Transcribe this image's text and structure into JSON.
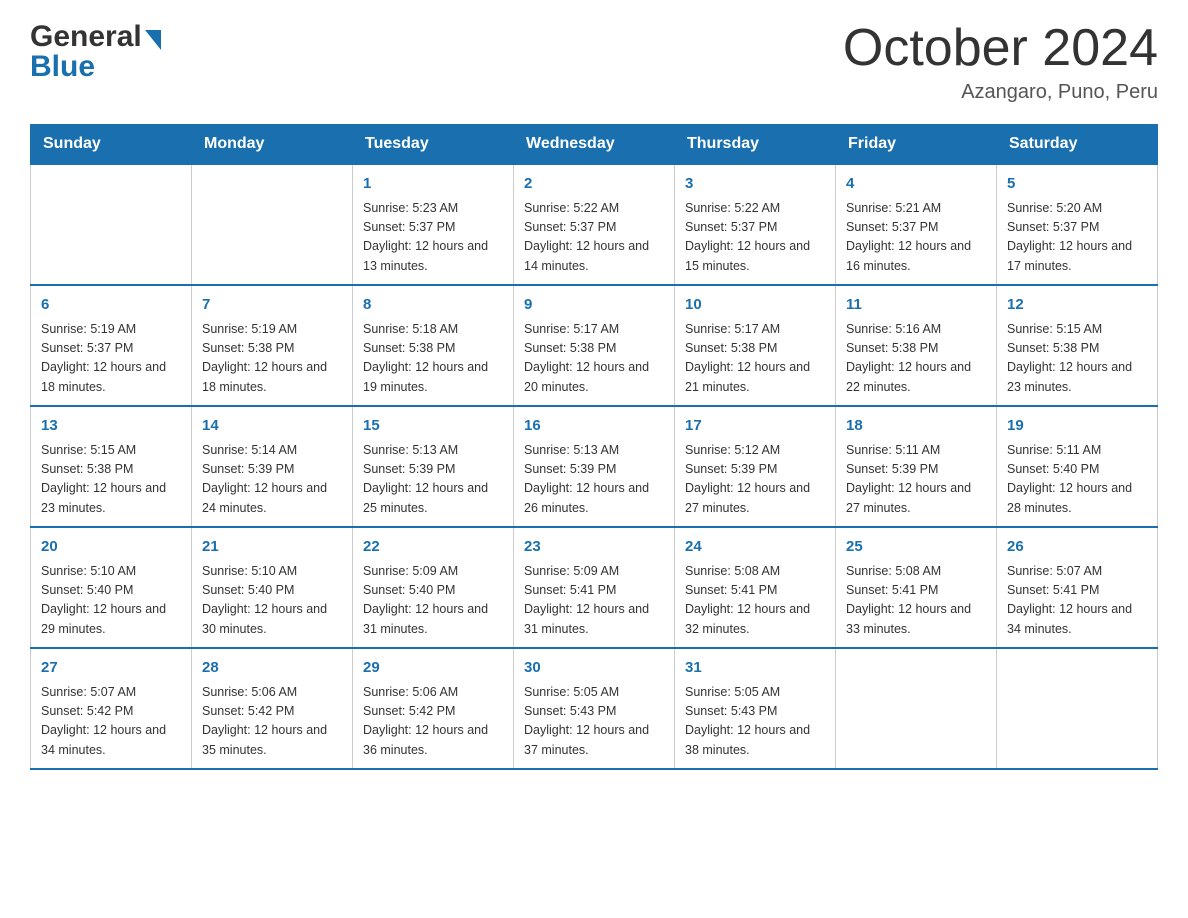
{
  "logo": {
    "general": "General",
    "blue": "Blue",
    "arrow": "▶"
  },
  "title": {
    "month": "October 2024",
    "location": "Azangaro, Puno, Peru"
  },
  "headers": [
    "Sunday",
    "Monday",
    "Tuesday",
    "Wednesday",
    "Thursday",
    "Friday",
    "Saturday"
  ],
  "weeks": [
    [
      {
        "day": "",
        "sunrise": "",
        "sunset": "",
        "daylight": ""
      },
      {
        "day": "",
        "sunrise": "",
        "sunset": "",
        "daylight": ""
      },
      {
        "day": "1",
        "sunrise": "Sunrise: 5:23 AM",
        "sunset": "Sunset: 5:37 PM",
        "daylight": "Daylight: 12 hours and 13 minutes."
      },
      {
        "day": "2",
        "sunrise": "Sunrise: 5:22 AM",
        "sunset": "Sunset: 5:37 PM",
        "daylight": "Daylight: 12 hours and 14 minutes."
      },
      {
        "day": "3",
        "sunrise": "Sunrise: 5:22 AM",
        "sunset": "Sunset: 5:37 PM",
        "daylight": "Daylight: 12 hours and 15 minutes."
      },
      {
        "day": "4",
        "sunrise": "Sunrise: 5:21 AM",
        "sunset": "Sunset: 5:37 PM",
        "daylight": "Daylight: 12 hours and 16 minutes."
      },
      {
        "day": "5",
        "sunrise": "Sunrise: 5:20 AM",
        "sunset": "Sunset: 5:37 PM",
        "daylight": "Daylight: 12 hours and 17 minutes."
      }
    ],
    [
      {
        "day": "6",
        "sunrise": "Sunrise: 5:19 AM",
        "sunset": "Sunset: 5:37 PM",
        "daylight": "Daylight: 12 hours and 18 minutes."
      },
      {
        "day": "7",
        "sunrise": "Sunrise: 5:19 AM",
        "sunset": "Sunset: 5:38 PM",
        "daylight": "Daylight: 12 hours and 18 minutes."
      },
      {
        "day": "8",
        "sunrise": "Sunrise: 5:18 AM",
        "sunset": "Sunset: 5:38 PM",
        "daylight": "Daylight: 12 hours and 19 minutes."
      },
      {
        "day": "9",
        "sunrise": "Sunrise: 5:17 AM",
        "sunset": "Sunset: 5:38 PM",
        "daylight": "Daylight: 12 hours and 20 minutes."
      },
      {
        "day": "10",
        "sunrise": "Sunrise: 5:17 AM",
        "sunset": "Sunset: 5:38 PM",
        "daylight": "Daylight: 12 hours and 21 minutes."
      },
      {
        "day": "11",
        "sunrise": "Sunrise: 5:16 AM",
        "sunset": "Sunset: 5:38 PM",
        "daylight": "Daylight: 12 hours and 22 minutes."
      },
      {
        "day": "12",
        "sunrise": "Sunrise: 5:15 AM",
        "sunset": "Sunset: 5:38 PM",
        "daylight": "Daylight: 12 hours and 23 minutes."
      }
    ],
    [
      {
        "day": "13",
        "sunrise": "Sunrise: 5:15 AM",
        "sunset": "Sunset: 5:38 PM",
        "daylight": "Daylight: 12 hours and 23 minutes."
      },
      {
        "day": "14",
        "sunrise": "Sunrise: 5:14 AM",
        "sunset": "Sunset: 5:39 PM",
        "daylight": "Daylight: 12 hours and 24 minutes."
      },
      {
        "day": "15",
        "sunrise": "Sunrise: 5:13 AM",
        "sunset": "Sunset: 5:39 PM",
        "daylight": "Daylight: 12 hours and 25 minutes."
      },
      {
        "day": "16",
        "sunrise": "Sunrise: 5:13 AM",
        "sunset": "Sunset: 5:39 PM",
        "daylight": "Daylight: 12 hours and 26 minutes."
      },
      {
        "day": "17",
        "sunrise": "Sunrise: 5:12 AM",
        "sunset": "Sunset: 5:39 PM",
        "daylight": "Daylight: 12 hours and 27 minutes."
      },
      {
        "day": "18",
        "sunrise": "Sunrise: 5:11 AM",
        "sunset": "Sunset: 5:39 PM",
        "daylight": "Daylight: 12 hours and 27 minutes."
      },
      {
        "day": "19",
        "sunrise": "Sunrise: 5:11 AM",
        "sunset": "Sunset: 5:40 PM",
        "daylight": "Daylight: 12 hours and 28 minutes."
      }
    ],
    [
      {
        "day": "20",
        "sunrise": "Sunrise: 5:10 AM",
        "sunset": "Sunset: 5:40 PM",
        "daylight": "Daylight: 12 hours and 29 minutes."
      },
      {
        "day": "21",
        "sunrise": "Sunrise: 5:10 AM",
        "sunset": "Sunset: 5:40 PM",
        "daylight": "Daylight: 12 hours and 30 minutes."
      },
      {
        "day": "22",
        "sunrise": "Sunrise: 5:09 AM",
        "sunset": "Sunset: 5:40 PM",
        "daylight": "Daylight: 12 hours and 31 minutes."
      },
      {
        "day": "23",
        "sunrise": "Sunrise: 5:09 AM",
        "sunset": "Sunset: 5:41 PM",
        "daylight": "Daylight: 12 hours and 31 minutes."
      },
      {
        "day": "24",
        "sunrise": "Sunrise: 5:08 AM",
        "sunset": "Sunset: 5:41 PM",
        "daylight": "Daylight: 12 hours and 32 minutes."
      },
      {
        "day": "25",
        "sunrise": "Sunrise: 5:08 AM",
        "sunset": "Sunset: 5:41 PM",
        "daylight": "Daylight: 12 hours and 33 minutes."
      },
      {
        "day": "26",
        "sunrise": "Sunrise: 5:07 AM",
        "sunset": "Sunset: 5:41 PM",
        "daylight": "Daylight: 12 hours and 34 minutes."
      }
    ],
    [
      {
        "day": "27",
        "sunrise": "Sunrise: 5:07 AM",
        "sunset": "Sunset: 5:42 PM",
        "daylight": "Daylight: 12 hours and 34 minutes."
      },
      {
        "day": "28",
        "sunrise": "Sunrise: 5:06 AM",
        "sunset": "Sunset: 5:42 PM",
        "daylight": "Daylight: 12 hours and 35 minutes."
      },
      {
        "day": "29",
        "sunrise": "Sunrise: 5:06 AM",
        "sunset": "Sunset: 5:42 PM",
        "daylight": "Daylight: 12 hours and 36 minutes."
      },
      {
        "day": "30",
        "sunrise": "Sunrise: 5:05 AM",
        "sunset": "Sunset: 5:43 PM",
        "daylight": "Daylight: 12 hours and 37 minutes."
      },
      {
        "day": "31",
        "sunrise": "Sunrise: 5:05 AM",
        "sunset": "Sunset: 5:43 PM",
        "daylight": "Daylight: 12 hours and 38 minutes."
      },
      {
        "day": "",
        "sunrise": "",
        "sunset": "",
        "daylight": ""
      },
      {
        "day": "",
        "sunrise": "",
        "sunset": "",
        "daylight": ""
      }
    ]
  ]
}
